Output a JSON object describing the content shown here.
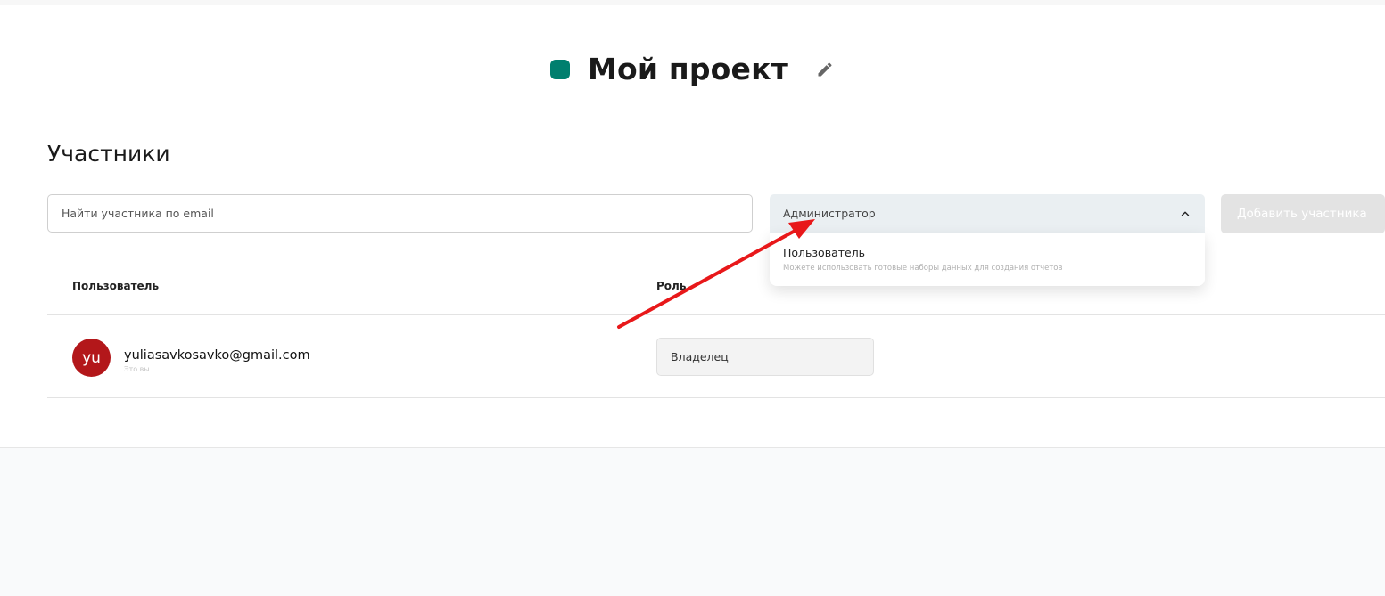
{
  "project": {
    "title": "Мой проект",
    "dot_color": "#007f6e"
  },
  "members": {
    "section_title": "Участники",
    "search_placeholder": "Найти участника по email",
    "role_select": {
      "selected": "Администратор",
      "options": [
        {
          "title": "Пользователь",
          "description": "Можете использовать готовые наборы данных для создания отчетов"
        }
      ]
    },
    "add_button_label": "Добавить участника",
    "table": {
      "columns": [
        "Пользователь",
        "Роль"
      ],
      "rows": [
        {
          "avatar_initials": "yu",
          "avatar_color": "#b3171a",
          "email": "yuliasavkosavko@gmail.com",
          "note": "Это вы",
          "role": "Владелец"
        }
      ]
    }
  },
  "annotation": {
    "arrow_color": "#e8181a"
  },
  "icons": {
    "edit": "pencil-icon",
    "select_toggle": "chevron-up-icon"
  }
}
